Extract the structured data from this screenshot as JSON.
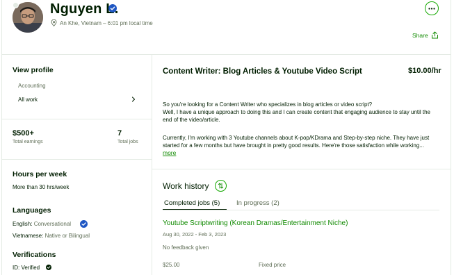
{
  "profile": {
    "name": "Nguyen L.",
    "location": "An Khe, Vietnam – 6:01 pm local time",
    "share_label": "Share"
  },
  "sidebar": {
    "view_profile_label": "View profile",
    "items": [
      {
        "label": "Accounting"
      },
      {
        "label": "All work"
      }
    ],
    "stats": {
      "earnings_value": "$500+",
      "earnings_label": "Total earnings",
      "jobs_value": "7",
      "jobs_label": "Total jobs"
    },
    "hours": {
      "title": "Hours per week",
      "value": "More than 30 hrs/week"
    },
    "languages": {
      "title": "Languages",
      "list": [
        {
          "name": "English:",
          "level": "Conversational"
        },
        {
          "name": "Vietnamese:",
          "level": "Native or Bilingual"
        }
      ]
    },
    "verifications": {
      "title": "Verifications",
      "id_label": "ID: Verified"
    }
  },
  "main": {
    "title": "Content Writer: Blog Articles & Youtube Video Script",
    "rate": "$10.00/hr",
    "description": [
      "So you're looking for a Content Writer who specializes in blog articles or video script?",
      "Well, I have a unique approach to doing this and I can create content that engaging audience to stay until the",
      "end of the video/article.",
      "Currently, I'm working with 3 Youtube channels about K-pop/KDrama and Step-by-step niche. They have just",
      "started for a few months but have brought in pretty good results. Here're those satisfaction while working..."
    ],
    "more_label": "more"
  },
  "work_history": {
    "title": "Work history",
    "tabs": [
      {
        "label": "Completed jobs (5)"
      },
      {
        "label": "In progress (2)"
      }
    ],
    "job": {
      "title": "Youtube Scriptwriting (Korean Dramas/Entertainment Niche)",
      "dates": "Aug 30, 2022 - Feb 3, 2023",
      "feedback": "No feedback given",
      "amount": "$25.00",
      "price_type": "Fixed price"
    }
  },
  "colors": {
    "accent": "#14a800",
    "link": "#108a00",
    "verified": "#1f57c3"
  }
}
